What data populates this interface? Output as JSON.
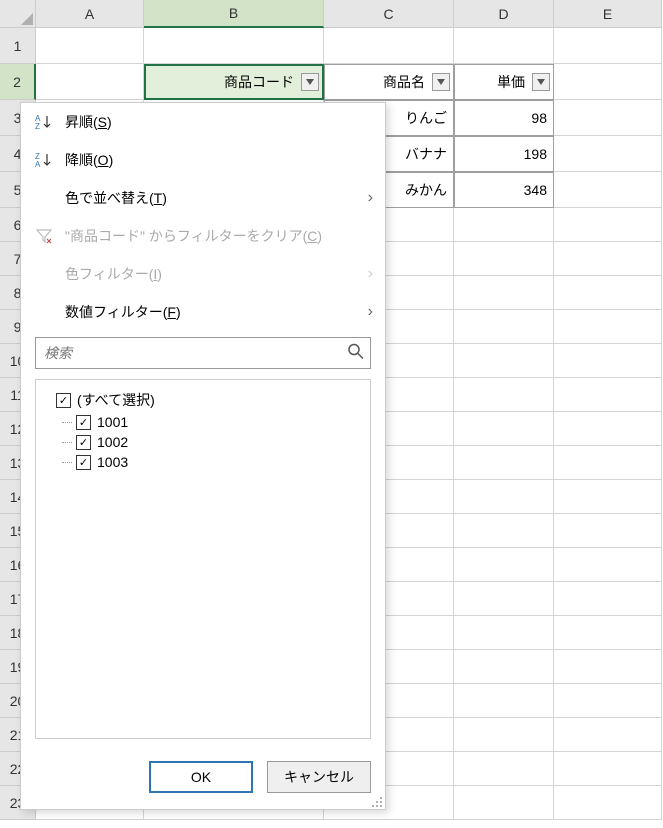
{
  "columns": {
    "A": "A",
    "B": "B",
    "C": "C",
    "D": "D",
    "E": "E"
  },
  "row_labels": [
    "1",
    "2",
    "3",
    "4",
    "5",
    "6",
    "7",
    "8",
    "9",
    "10",
    "11",
    "12",
    "13",
    "14",
    "15",
    "16",
    "17",
    "18",
    "19",
    "20",
    "21",
    "22",
    "23"
  ],
  "headers": {
    "b": "商品コード",
    "c": "商品名",
    "d": "単価"
  },
  "data_rows": [
    {
      "c": "りんご",
      "d": "98"
    },
    {
      "c": "バナナ",
      "d": "198"
    },
    {
      "c": "みかん",
      "d": "348"
    }
  ],
  "menu": {
    "sort_asc": "昇順(",
    "sort_asc_key": "S",
    "sort_asc_end": ")",
    "sort_desc": "降順(",
    "sort_desc_key": "O",
    "sort_desc_end": ")",
    "sort_color": "色で並べ替え(",
    "sort_color_key": "T",
    "sort_color_end": ")",
    "clear_filter_pre": "\"",
    "clear_filter_field": "商品コード",
    "clear_filter_mid": "\" からフィルターをクリア(",
    "clear_filter_key": "C",
    "clear_filter_end": ")",
    "color_filter": "色フィルター(",
    "color_filter_key": "I",
    "color_filter_end": ")",
    "number_filter": "数値フィルター(",
    "number_filter_key": "F",
    "number_filter_end": ")",
    "search_placeholder": "検索",
    "select_all": "(すべて選択)",
    "items": [
      "1001",
      "1002",
      "1003"
    ],
    "ok": "OK",
    "cancel": "キャンセル"
  }
}
